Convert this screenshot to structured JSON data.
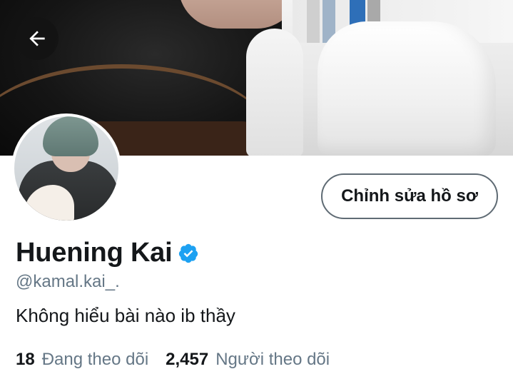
{
  "header": {
    "back_icon": "arrow-left-icon"
  },
  "profile": {
    "edit_button_label": "Chỉnh sửa hồ sơ",
    "display_name": "Huening Kai",
    "verified_icon": "verified-badge-icon",
    "handle": "@kamal.kai_.",
    "bio": "Không hiểu bài nào ib thầy"
  },
  "stats": {
    "following_count": "18",
    "following_label": "Đang theo dõi",
    "followers_count": "2,457",
    "followers_label": "Người theo dõi"
  },
  "colors": {
    "text_primary": "#14171a",
    "text_secondary": "#657786",
    "verified_blue": "#1da1f2",
    "button_border": "#5f6b74"
  }
}
